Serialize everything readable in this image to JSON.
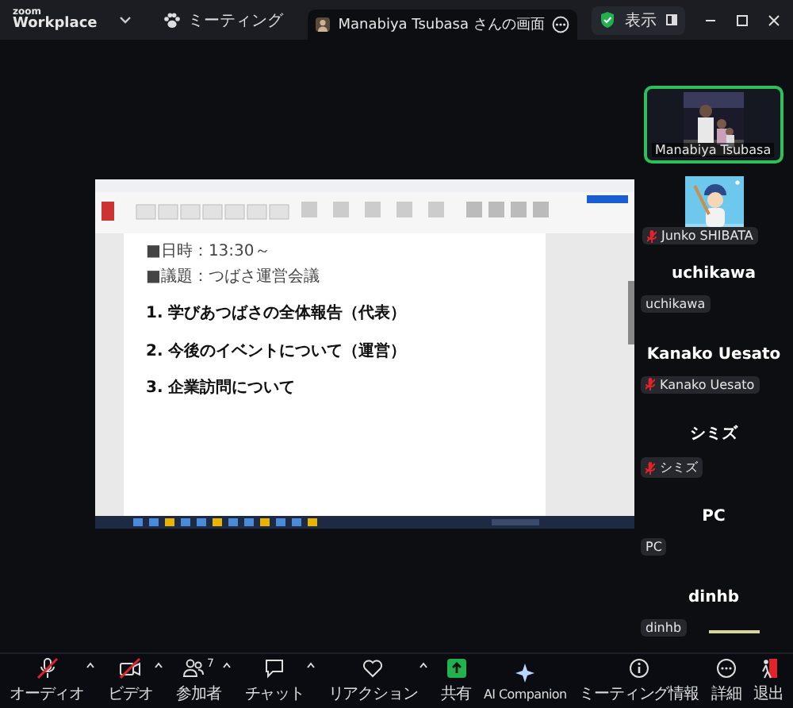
{
  "app": {
    "logo_small": "zoom",
    "logo": "Workplace",
    "menu": "ミーティング"
  },
  "share_tab": {
    "title": "Manabiya Tsubasa さんの画面"
  },
  "view_button": {
    "label": "表示"
  },
  "shared_document": {
    "lines": [
      {
        "text": "■日時：13:30～",
        "kind": "meta"
      },
      {
        "text": "■議題：つばさ運営会議",
        "kind": "meta"
      },
      {
        "text": "1. 学びあつばさの全体報告（代表）",
        "kind": "heading"
      },
      {
        "text": "2. 今後のイベントについて（運営）",
        "kind": "heading"
      },
      {
        "text": "3. 企業訪問について",
        "kind": "heading"
      }
    ]
  },
  "participants": [
    {
      "kind": "video",
      "name": "Manabiya Tsubasa",
      "speaking": true,
      "muted": false,
      "audio_indicator": false
    },
    {
      "kind": "avatar",
      "name": "Junko SHIBATA",
      "speaking": false,
      "muted": true,
      "audio_indicator": false
    },
    {
      "kind": "name",
      "display_name": "uchikawa",
      "name": "uchikawa",
      "speaking": false,
      "muted": false,
      "audio_indicator": false
    },
    {
      "kind": "name",
      "display_name": "Kanako Uesato",
      "name": "Kanako Uesato",
      "speaking": false,
      "muted": true,
      "audio_indicator": false
    },
    {
      "kind": "name",
      "display_name": "シミズ",
      "name": "シミズ",
      "speaking": false,
      "muted": true,
      "audio_indicator": false
    },
    {
      "kind": "name",
      "display_name": "PC",
      "name": "PC",
      "speaking": false,
      "muted": false,
      "audio_indicator": false
    },
    {
      "kind": "name",
      "display_name": "dinhb",
      "name": "dinhb",
      "speaking": false,
      "muted": false,
      "audio_indicator": true
    }
  ],
  "toolbar": [
    {
      "kind": "audio",
      "label": "オーディオ",
      "muted": true,
      "caret": true
    },
    {
      "kind": "video",
      "label": "ビデオ",
      "muted": true,
      "caret": true
    },
    {
      "kind": "participants",
      "label": "参加者",
      "count": "7",
      "caret": true
    },
    {
      "kind": "chat",
      "label": "チャット",
      "caret": true
    },
    {
      "kind": "reactions",
      "label": "リアクション",
      "caret": true
    },
    {
      "kind": "share",
      "label": "共有",
      "caret": false
    },
    {
      "kind": "ai",
      "label": "AI Companion",
      "caret": false
    },
    {
      "kind": "info",
      "label": "ミーティング情報",
      "caret": false
    },
    {
      "kind": "more",
      "label": "詳細",
      "caret": false
    },
    {
      "kind": "leave",
      "label": "退出",
      "caret": false
    }
  ]
}
